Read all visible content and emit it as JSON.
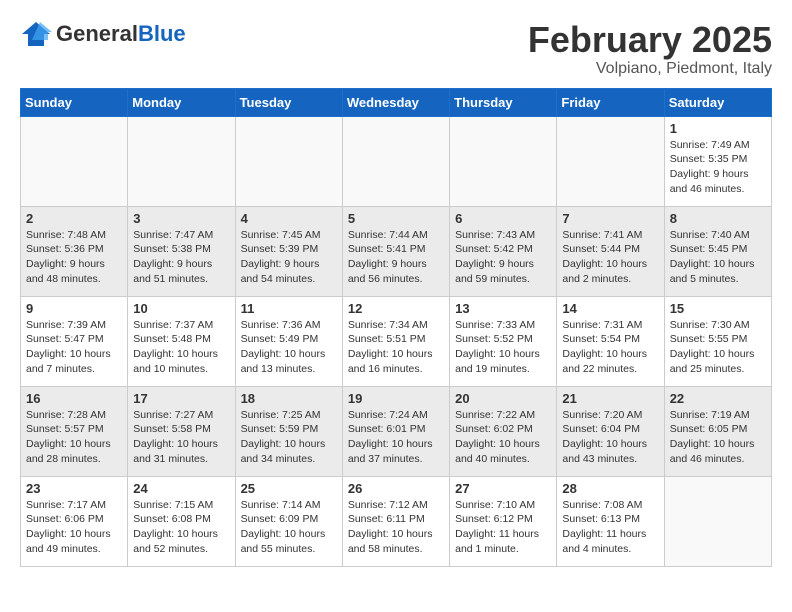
{
  "header": {
    "logo_general": "General",
    "logo_blue": "Blue",
    "month_title": "February 2025",
    "location": "Volpiano, Piedmont, Italy"
  },
  "weekdays": [
    "Sunday",
    "Monday",
    "Tuesday",
    "Wednesday",
    "Thursday",
    "Friday",
    "Saturday"
  ],
  "weeks": [
    [
      {
        "day": "",
        "info": ""
      },
      {
        "day": "",
        "info": ""
      },
      {
        "day": "",
        "info": ""
      },
      {
        "day": "",
        "info": ""
      },
      {
        "day": "",
        "info": ""
      },
      {
        "day": "",
        "info": ""
      },
      {
        "day": "1",
        "info": "Sunrise: 7:49 AM\nSunset: 5:35 PM\nDaylight: 9 hours and 46 minutes."
      }
    ],
    [
      {
        "day": "2",
        "info": "Sunrise: 7:48 AM\nSunset: 5:36 PM\nDaylight: 9 hours and 48 minutes."
      },
      {
        "day": "3",
        "info": "Sunrise: 7:47 AM\nSunset: 5:38 PM\nDaylight: 9 hours and 51 minutes."
      },
      {
        "day": "4",
        "info": "Sunrise: 7:45 AM\nSunset: 5:39 PM\nDaylight: 9 hours and 54 minutes."
      },
      {
        "day": "5",
        "info": "Sunrise: 7:44 AM\nSunset: 5:41 PM\nDaylight: 9 hours and 56 minutes."
      },
      {
        "day": "6",
        "info": "Sunrise: 7:43 AM\nSunset: 5:42 PM\nDaylight: 9 hours and 59 minutes."
      },
      {
        "day": "7",
        "info": "Sunrise: 7:41 AM\nSunset: 5:44 PM\nDaylight: 10 hours and 2 minutes."
      },
      {
        "day": "8",
        "info": "Sunrise: 7:40 AM\nSunset: 5:45 PM\nDaylight: 10 hours and 5 minutes."
      }
    ],
    [
      {
        "day": "9",
        "info": "Sunrise: 7:39 AM\nSunset: 5:47 PM\nDaylight: 10 hours and 7 minutes."
      },
      {
        "day": "10",
        "info": "Sunrise: 7:37 AM\nSunset: 5:48 PM\nDaylight: 10 hours and 10 minutes."
      },
      {
        "day": "11",
        "info": "Sunrise: 7:36 AM\nSunset: 5:49 PM\nDaylight: 10 hours and 13 minutes."
      },
      {
        "day": "12",
        "info": "Sunrise: 7:34 AM\nSunset: 5:51 PM\nDaylight: 10 hours and 16 minutes."
      },
      {
        "day": "13",
        "info": "Sunrise: 7:33 AM\nSunset: 5:52 PM\nDaylight: 10 hours and 19 minutes."
      },
      {
        "day": "14",
        "info": "Sunrise: 7:31 AM\nSunset: 5:54 PM\nDaylight: 10 hours and 22 minutes."
      },
      {
        "day": "15",
        "info": "Sunrise: 7:30 AM\nSunset: 5:55 PM\nDaylight: 10 hours and 25 minutes."
      }
    ],
    [
      {
        "day": "16",
        "info": "Sunrise: 7:28 AM\nSunset: 5:57 PM\nDaylight: 10 hours and 28 minutes."
      },
      {
        "day": "17",
        "info": "Sunrise: 7:27 AM\nSunset: 5:58 PM\nDaylight: 10 hours and 31 minutes."
      },
      {
        "day": "18",
        "info": "Sunrise: 7:25 AM\nSunset: 5:59 PM\nDaylight: 10 hours and 34 minutes."
      },
      {
        "day": "19",
        "info": "Sunrise: 7:24 AM\nSunset: 6:01 PM\nDaylight: 10 hours and 37 minutes."
      },
      {
        "day": "20",
        "info": "Sunrise: 7:22 AM\nSunset: 6:02 PM\nDaylight: 10 hours and 40 minutes."
      },
      {
        "day": "21",
        "info": "Sunrise: 7:20 AM\nSunset: 6:04 PM\nDaylight: 10 hours and 43 minutes."
      },
      {
        "day": "22",
        "info": "Sunrise: 7:19 AM\nSunset: 6:05 PM\nDaylight: 10 hours and 46 minutes."
      }
    ],
    [
      {
        "day": "23",
        "info": "Sunrise: 7:17 AM\nSunset: 6:06 PM\nDaylight: 10 hours and 49 minutes."
      },
      {
        "day": "24",
        "info": "Sunrise: 7:15 AM\nSunset: 6:08 PM\nDaylight: 10 hours and 52 minutes."
      },
      {
        "day": "25",
        "info": "Sunrise: 7:14 AM\nSunset: 6:09 PM\nDaylight: 10 hours and 55 minutes."
      },
      {
        "day": "26",
        "info": "Sunrise: 7:12 AM\nSunset: 6:11 PM\nDaylight: 10 hours and 58 minutes."
      },
      {
        "day": "27",
        "info": "Sunrise: 7:10 AM\nSunset: 6:12 PM\nDaylight: 11 hours and 1 minute."
      },
      {
        "day": "28",
        "info": "Sunrise: 7:08 AM\nSunset: 6:13 PM\nDaylight: 11 hours and 4 minutes."
      },
      {
        "day": "",
        "info": ""
      }
    ]
  ]
}
